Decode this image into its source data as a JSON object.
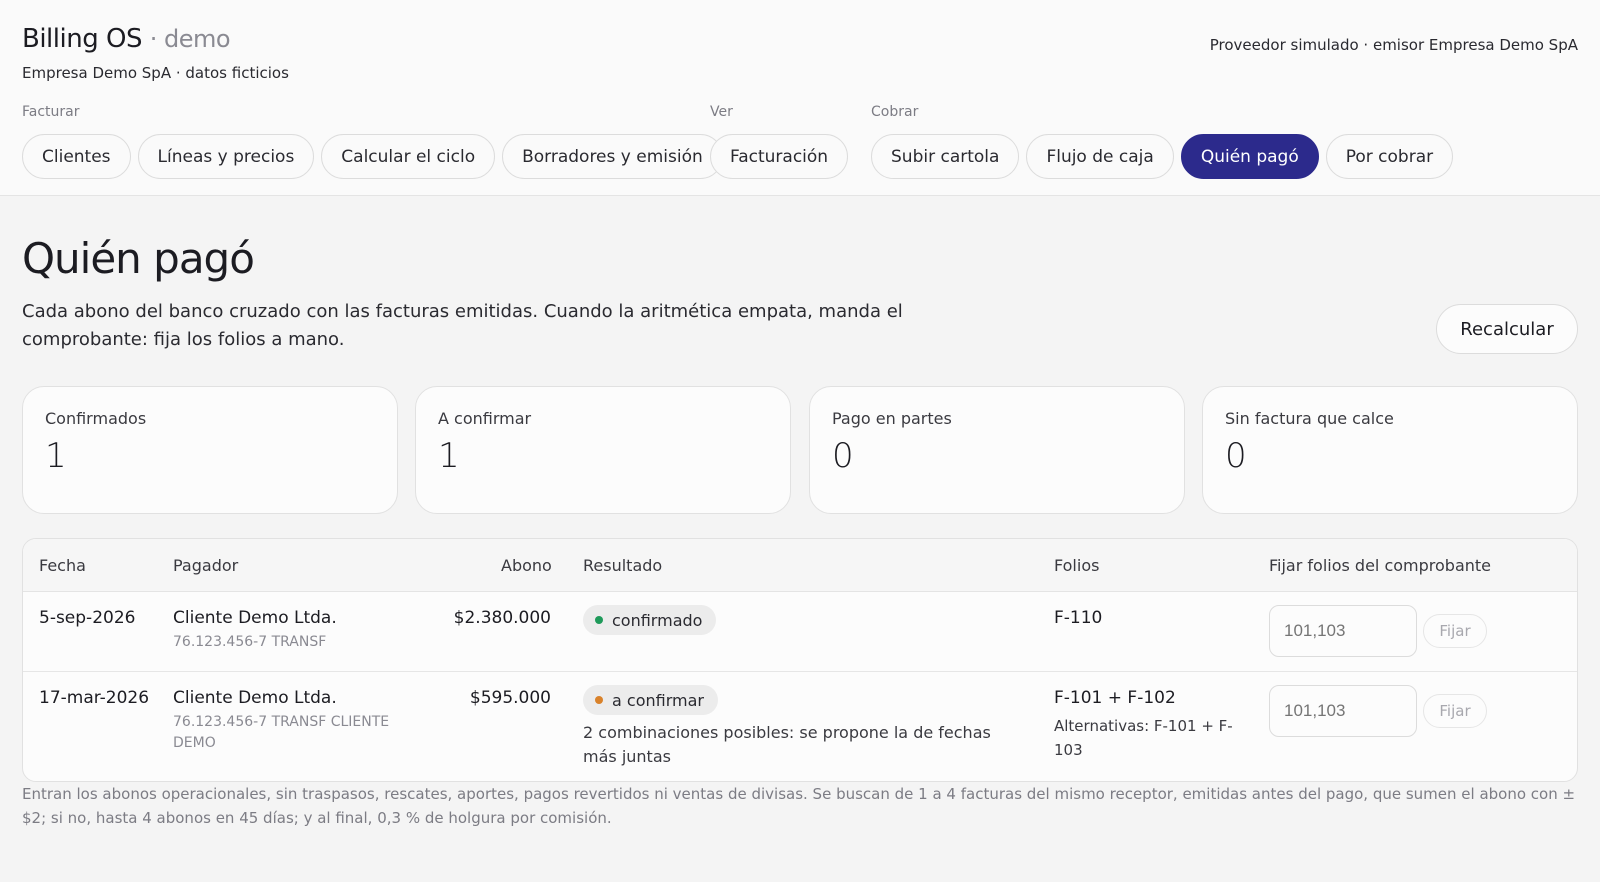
{
  "header": {
    "brand": "Billing OS",
    "brand_suffix": "· demo",
    "subtitle": "Empresa Demo SpA · datos ficticios",
    "provider": "Proveedor simulado · emisor Empresa Demo SpA"
  },
  "nav": {
    "groups": [
      {
        "label": "Facturar",
        "items": [
          "Clientes",
          "Líneas y precios",
          "Calcular el ciclo",
          "Borradores y emisión"
        ]
      },
      {
        "label": "Ver",
        "items": [
          "Facturación"
        ]
      },
      {
        "label": "Cobrar",
        "items": [
          "Subir cartola",
          "Flujo de caja",
          "Quién pagó",
          "Por cobrar"
        ]
      }
    ],
    "active": "Quién pagó"
  },
  "page": {
    "title": "Quién pagó",
    "description": "Cada abono del banco cruzado con las facturas emitidas. Cuando la aritmética empata, manda el comprobante: fija los folios a mano.",
    "recalc_label": "Recalcular"
  },
  "cards": [
    {
      "label": "Confirmados",
      "value": "1"
    },
    {
      "label": "A confirmar",
      "value": "1"
    },
    {
      "label": "Pago en partes",
      "value": "0"
    },
    {
      "label": "Sin factura que calce",
      "value": "0"
    }
  ],
  "table": {
    "headers": [
      "Fecha",
      "Pagador",
      "Abono",
      "Resultado",
      "Folios",
      "Fijar folios del comprobante"
    ],
    "rows": [
      {
        "fecha": "5-sep-2026",
        "pagador": "Cliente Demo Ltda.",
        "pagador_detalle": "76.123.456-7 TRANSF",
        "abono": "$2.380.000",
        "resultado": "confirmado",
        "nota": "",
        "folios": "F-110",
        "alternativas": "",
        "placeholder": "101,103",
        "fijar_label": "Fijar"
      },
      {
        "fecha": "17-mar-2026",
        "pagador": "Cliente Demo Ltda.",
        "pagador_detalle": "76.123.456-7 TRANSF CLIENTE DEMO",
        "abono": "$595.000",
        "resultado": "a confirmar",
        "nota": "2 combinaciones posibles: se propone la de fechas más juntas",
        "folios": "F-101 + F-102",
        "alternativas": "Alternativas: F-101 + F-103",
        "placeholder": "101,103",
        "fijar_label": "Fijar"
      }
    ]
  },
  "status_colors": {
    "confirmado": "#1f9a5a",
    "a confirmar": "#d9822b"
  },
  "accent": "#2c2a8c",
  "footnote": "Entran los abonos operacionales, sin traspasos, rescates, aportes, pagos revertidos ni ventas de divisas. Se buscan de 1 a 4 facturas del mismo receptor, emitidas antes del pago, que sumen el abono con ±$2; si no, hasta 4 abonos en 45 días; y al final, 0,3 % de holgura por comisión."
}
